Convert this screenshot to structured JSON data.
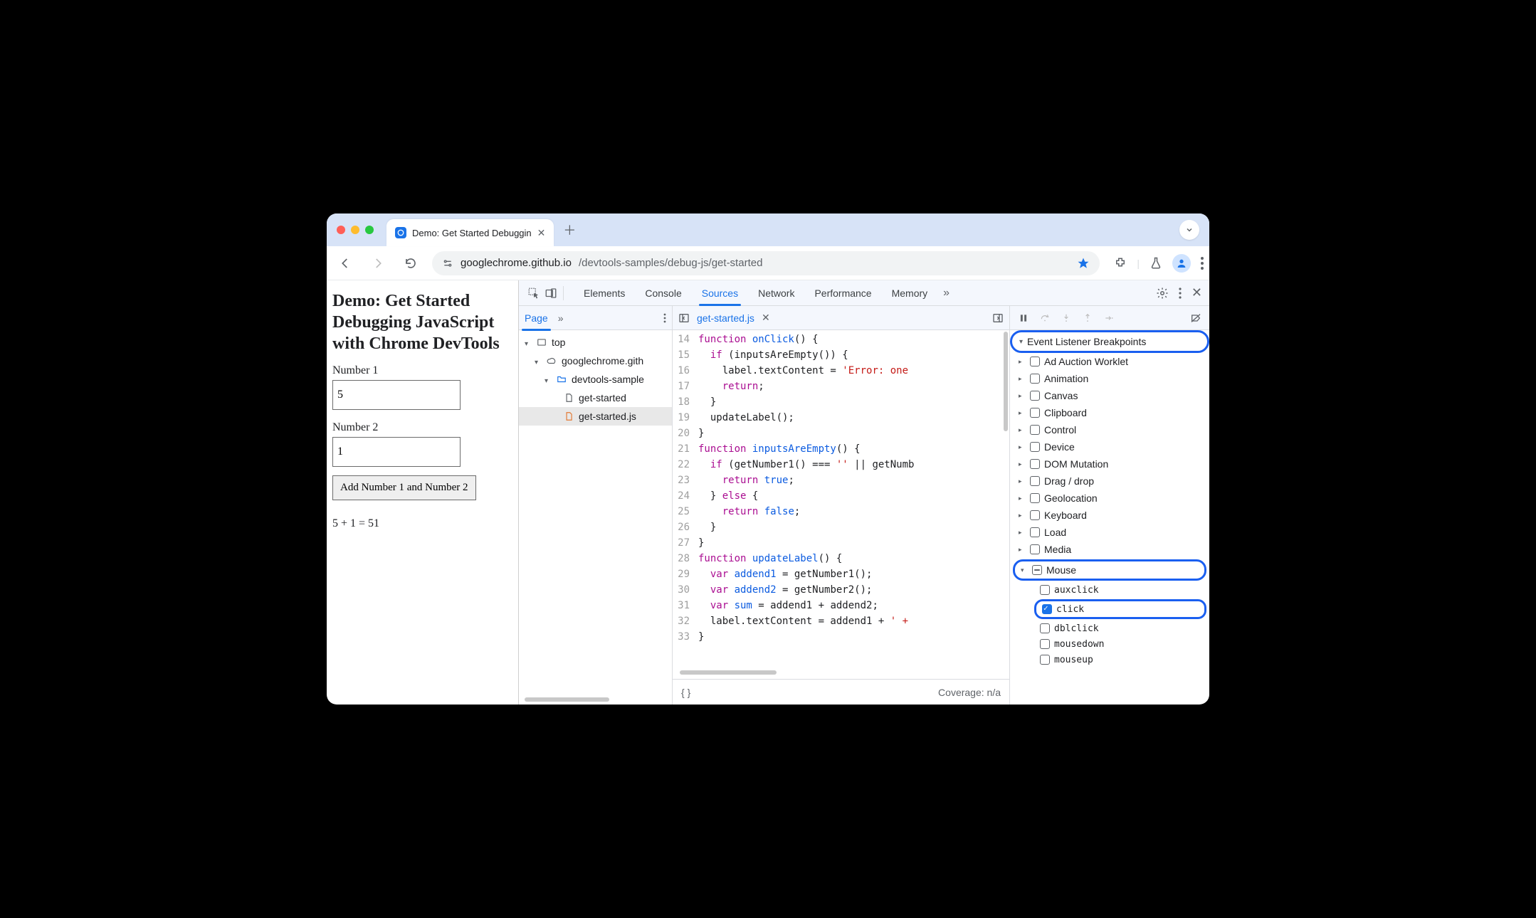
{
  "browser": {
    "tab_title": "Demo: Get Started Debuggin",
    "url_host": "googlechrome.github.io",
    "url_path": "/devtools-samples/debug-js/get-started",
    "starred": true
  },
  "page": {
    "heading": "Demo: Get Started Debugging JavaScript with Chrome DevTools",
    "label_num1": "Number 1",
    "input_num1": "5",
    "label_num2": "Number 2",
    "input_num2": "1",
    "add_button": "Add Number 1 and Number 2",
    "result_text": "5 + 1 = 51"
  },
  "devtools": {
    "main_tabs": [
      "Elements",
      "Console",
      "Sources",
      "Network",
      "Performance",
      "Memory"
    ],
    "main_active": "Sources",
    "navigator": {
      "page_tab": "Page",
      "tree": {
        "top": "top",
        "domain": "googlechrome.gith",
        "folder": "devtools-sample",
        "file_html": "get-started",
        "file_js": "get-started.js"
      }
    },
    "editor": {
      "open_file": "get-started.js",
      "coverage": "Coverage: n/a",
      "first_line_no": 14,
      "code_lines": [
        {
          "n": 14,
          "tokens": [
            [
              "t-func",
              "function "
            ],
            [
              "t-name",
              "onClick"
            ],
            [
              "t-plain",
              "() {"
            ]
          ]
        },
        {
          "n": 15,
          "tokens": [
            [
              "t-plain",
              "  "
            ],
            [
              "t-func",
              "if"
            ],
            [
              "t-plain",
              " (inputsAreEmpty()) {"
            ]
          ]
        },
        {
          "n": 16,
          "tokens": [
            [
              "t-plain",
              "    label.textContent = "
            ],
            [
              "t-str",
              "'Error: one"
            ]
          ]
        },
        {
          "n": 17,
          "tokens": [
            [
              "t-plain",
              "    "
            ],
            [
              "t-func",
              "return"
            ],
            [
              "t-plain",
              ";"
            ]
          ]
        },
        {
          "n": 18,
          "tokens": [
            [
              "t-plain",
              "  }"
            ]
          ]
        },
        {
          "n": 19,
          "tokens": [
            [
              "t-plain",
              "  updateLabel();"
            ]
          ]
        },
        {
          "n": 20,
          "tokens": [
            [
              "t-plain",
              "}"
            ]
          ]
        },
        {
          "n": 21,
          "tokens": [
            [
              "t-func",
              "function "
            ],
            [
              "t-name",
              "inputsAreEmpty"
            ],
            [
              "t-plain",
              "() {"
            ]
          ]
        },
        {
          "n": 22,
          "tokens": [
            [
              "t-plain",
              "  "
            ],
            [
              "t-func",
              "if"
            ],
            [
              "t-plain",
              " (getNumber1() === "
            ],
            [
              "t-str",
              "''"
            ],
            [
              "t-plain",
              " || getNumb"
            ]
          ]
        },
        {
          "n": 23,
          "tokens": [
            [
              "t-plain",
              "    "
            ],
            [
              "t-func",
              "return "
            ],
            [
              "t-name",
              "true"
            ],
            [
              "t-plain",
              ";"
            ]
          ]
        },
        {
          "n": 24,
          "tokens": [
            [
              "t-plain",
              "  } "
            ],
            [
              "t-func",
              "else"
            ],
            [
              "t-plain",
              " {"
            ]
          ]
        },
        {
          "n": 25,
          "tokens": [
            [
              "t-plain",
              "    "
            ],
            [
              "t-func",
              "return "
            ],
            [
              "t-name",
              "false"
            ],
            [
              "t-plain",
              ";"
            ]
          ]
        },
        {
          "n": 26,
          "tokens": [
            [
              "t-plain",
              "  }"
            ]
          ]
        },
        {
          "n": 27,
          "tokens": [
            [
              "t-plain",
              "}"
            ]
          ]
        },
        {
          "n": 28,
          "tokens": [
            [
              "t-func",
              "function "
            ],
            [
              "t-name",
              "updateLabel"
            ],
            [
              "t-plain",
              "() {"
            ]
          ]
        },
        {
          "n": 29,
          "tokens": [
            [
              "t-plain",
              "  "
            ],
            [
              "t-func",
              "var "
            ],
            [
              "t-name",
              "addend1"
            ],
            [
              "t-plain",
              " = getNumber1();"
            ]
          ]
        },
        {
          "n": 30,
          "tokens": [
            [
              "t-plain",
              "  "
            ],
            [
              "t-func",
              "var "
            ],
            [
              "t-name",
              "addend2"
            ],
            [
              "t-plain",
              " = getNumber2();"
            ]
          ]
        },
        {
          "n": 31,
          "tokens": [
            [
              "t-plain",
              "  "
            ],
            [
              "t-func",
              "var "
            ],
            [
              "t-name",
              "sum"
            ],
            [
              "t-plain",
              " = addend1 + addend2;"
            ]
          ]
        },
        {
          "n": 32,
          "tokens": [
            [
              "t-plain",
              "  label.textContent = addend1 + "
            ],
            [
              "t-str",
              "' +"
            ]
          ]
        },
        {
          "n": 33,
          "tokens": [
            [
              "t-plain",
              "}"
            ]
          ]
        }
      ]
    },
    "debugger": {
      "section_title": "Event Listener Breakpoints",
      "categories": [
        {
          "label": "Ad Auction Worklet",
          "state": "unchecked",
          "open": false
        },
        {
          "label": "Animation",
          "state": "unchecked",
          "open": false
        },
        {
          "label": "Canvas",
          "state": "unchecked",
          "open": false
        },
        {
          "label": "Clipboard",
          "state": "unchecked",
          "open": false
        },
        {
          "label": "Control",
          "state": "unchecked",
          "open": false
        },
        {
          "label": "Device",
          "state": "unchecked",
          "open": false
        },
        {
          "label": "DOM Mutation",
          "state": "unchecked",
          "open": false
        },
        {
          "label": "Drag / drop",
          "state": "unchecked",
          "open": false
        },
        {
          "label": "Geolocation",
          "state": "unchecked",
          "open": false
        },
        {
          "label": "Keyboard",
          "state": "unchecked",
          "open": false
        },
        {
          "label": "Load",
          "state": "unchecked",
          "open": false
        },
        {
          "label": "Media",
          "state": "unchecked",
          "open": false
        },
        {
          "label": "Mouse",
          "state": "indeterminate",
          "open": true,
          "highlight": true,
          "children": [
            {
              "label": "auxclick",
              "state": "unchecked"
            },
            {
              "label": "click",
              "state": "checked",
              "highlight": true
            },
            {
              "label": "dblclick",
              "state": "unchecked"
            },
            {
              "label": "mousedown",
              "state": "unchecked"
            },
            {
              "label": "mouseup",
              "state": "unchecked"
            }
          ]
        }
      ]
    }
  }
}
